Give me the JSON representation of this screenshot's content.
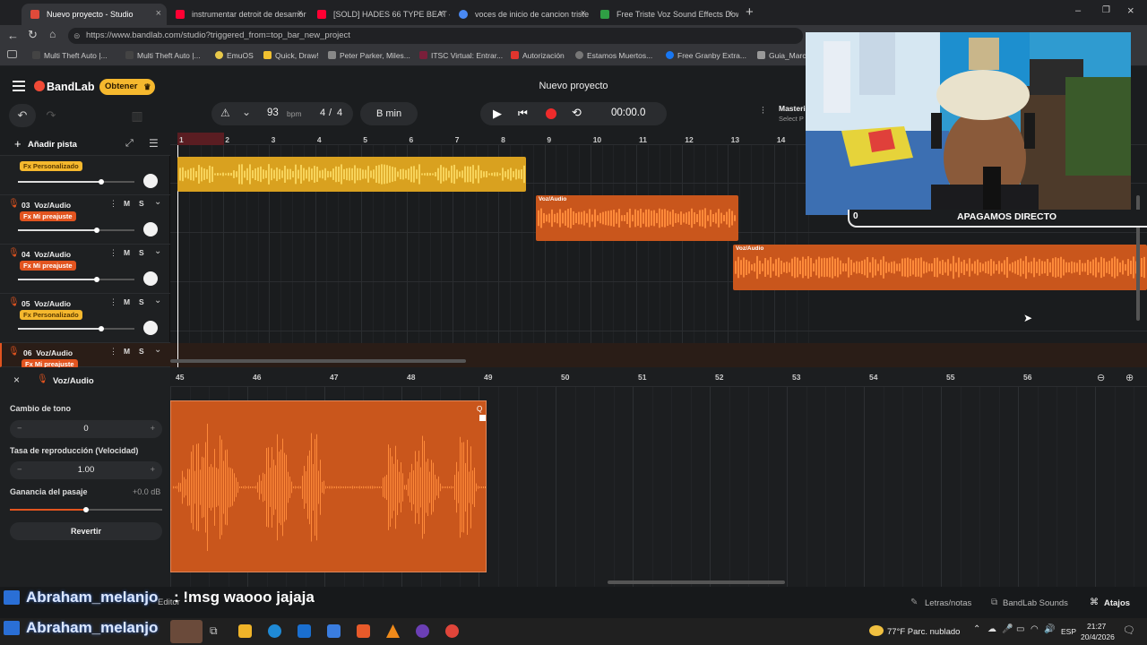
{
  "browser": {
    "tabs": [
      {
        "label": "Nuevo proyecto - Studio",
        "color": "#e04a3a",
        "active": true
      },
      {
        "label": "instrumentar detroit de desamor -",
        "color": "#ff0033",
        "active": false
      },
      {
        "label": "[SOLD] HADES 66 TYPE BEAT – \"T",
        "color": "#ff0033",
        "active": false
      },
      {
        "label": "voces de inicio de cancion triste -",
        "color": "#4a8af4",
        "active": false
      },
      {
        "label": "Free Triste Voz Sound Effects Dow",
        "color": "#2f9e44",
        "active": false
      }
    ],
    "url": "https://www.bandlab.com/studio?triggered_from=top_bar_new_project",
    "bookmarks": [
      "Multi Theft Auto |...",
      "Multi Theft Auto |...",
      "EmuOS",
      "Quick, Draw!",
      "Peter Parker, Miles...",
      "ITSC Virtual: Entrar...",
      "Autorización",
      "Estamos Muertos...",
      "Free Granby Extra...",
      "Guia_Marco"
    ]
  },
  "app": {
    "brand": "BandLab",
    "obtener": "Obtener",
    "project_title": "Nuevo proyecto",
    "bpm": "93",
    "bpm_unit": "bpm",
    "time_sig_num": "4",
    "time_sig_sep": "/",
    "time_sig_den": "4",
    "key": "B min",
    "time": "00:00.0",
    "mastering": "Masteri",
    "mastering_sub": "Select P",
    "add_track": "Añadir pista"
  },
  "ruler": [
    "1",
    "2",
    "3",
    "4",
    "5",
    "6",
    "7",
    "8",
    "9",
    "10",
    "11",
    "12",
    "13",
    "14"
  ],
  "tracks": [
    {
      "num": "",
      "name": "",
      "fx": "Fx Personalizado",
      "fx_color": "#f5b82e",
      "fx_text": "#5a3a00",
      "m": "M",
      "s": "S"
    },
    {
      "num": "03",
      "name": "Voz/Audio",
      "fx": "Fx Mi preajuste",
      "fx_color": "#e2541f",
      "fx_text": "#fff",
      "m": "M",
      "s": "S"
    },
    {
      "num": "04",
      "name": "Voz/Audio",
      "fx": "Fx Mi preajuste",
      "fx_color": "#e2541f",
      "fx_text": "#fff",
      "m": "M",
      "s": "S"
    },
    {
      "num": "05",
      "name": "Voz/Audio",
      "fx": "Fx Personalizado",
      "fx_color": "#f5b82e",
      "fx_text": "#5a3a00",
      "m": "M",
      "s": "S"
    },
    {
      "num": "06",
      "name": "Voz/Audio",
      "fx": "Fx Mi preajuste",
      "fx_color": "#e2541f",
      "fx_text": "#fff",
      "m": "M",
      "s": "S"
    }
  ],
  "clips": [
    {
      "label": "",
      "color": "#d9a11f"
    },
    {
      "label": "Voz/Audio",
      "color": "#c9561c"
    },
    {
      "label": "Voz/Audio",
      "color": "#c9561c"
    }
  ],
  "editor": {
    "title": "Voz/Audio",
    "ruler": [
      "45",
      "46",
      "47",
      "48",
      "49",
      "50",
      "51",
      "52",
      "53",
      "54",
      "55",
      "56"
    ],
    "pitch_label": "Cambio de tono",
    "pitch_value": "0",
    "rate_label": "Tasa de reproducción (Velocidad)",
    "rate_value": "1.00",
    "gain_label": "Ganancia del pasaje",
    "gain_value": "+0.0 dB",
    "revert": "Revertir",
    "minus": "−",
    "plus": "+"
  },
  "bottom": {
    "lyrics": "Letras/notas",
    "sounds": "BandLab Sounds",
    "shortcuts": "Atajos",
    "chat_user": "Abraham_melanjo",
    "chat_msg": ": !msg waooo jajaja",
    "editor_tab": "Editor"
  },
  "overlay": {
    "count": "0",
    "text": "APAGAMOS DIRECTO"
  },
  "taskbar": {
    "weather": "77°F  Parc. nublado",
    "lang": "ESP",
    "time": "21:27",
    "date": "20/4/2026"
  }
}
